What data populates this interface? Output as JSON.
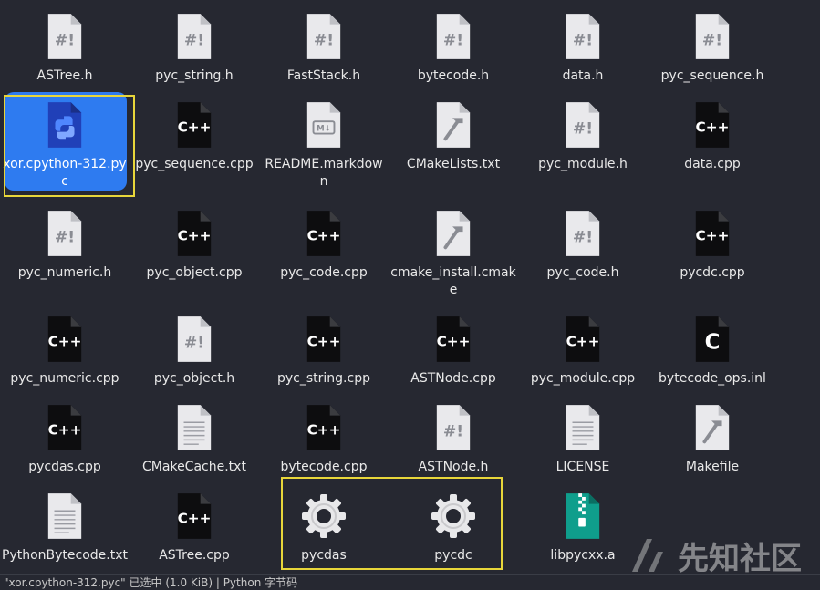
{
  "files": [
    {
      "name": "ASTree.h",
      "icon": "header-icon"
    },
    {
      "name": "pyc_string.h",
      "icon": "header-icon"
    },
    {
      "name": "FastStack.h",
      "icon": "header-icon"
    },
    {
      "name": "bytecode.h",
      "icon": "header-icon"
    },
    {
      "name": "data.h",
      "icon": "header-icon"
    },
    {
      "name": "pyc_sequence.h",
      "icon": "header-icon"
    },
    {
      "name": "xor.cpython-312.pyc",
      "icon": "python-icon",
      "selected": true
    },
    {
      "name": "pyc_sequence.cpp",
      "icon": "cpp-icon"
    },
    {
      "name": "README.markdown",
      "icon": "markdown-icon"
    },
    {
      "name": "CMakeLists.txt",
      "icon": "build-icon"
    },
    {
      "name": "pyc_module.h",
      "icon": "header-icon"
    },
    {
      "name": "data.cpp",
      "icon": "cpp-icon"
    },
    {
      "name": "pyc_numeric.h",
      "icon": "header-icon"
    },
    {
      "name": "pyc_object.cpp",
      "icon": "cpp-icon"
    },
    {
      "name": "pyc_code.cpp",
      "icon": "cpp-icon"
    },
    {
      "name": "cmake_install.cmake",
      "icon": "build-icon"
    },
    {
      "name": "pyc_code.h",
      "icon": "header-icon"
    },
    {
      "name": "pycdc.cpp",
      "icon": "cpp-icon"
    },
    {
      "name": "pyc_numeric.cpp",
      "icon": "cpp-icon"
    },
    {
      "name": "pyc_object.h",
      "icon": "header-icon"
    },
    {
      "name": "pyc_string.cpp",
      "icon": "cpp-icon"
    },
    {
      "name": "ASTNode.cpp",
      "icon": "cpp-icon"
    },
    {
      "name": "pyc_module.cpp",
      "icon": "cpp-icon"
    },
    {
      "name": "bytecode_ops.inl",
      "icon": "c-icon"
    },
    {
      "name": "pycdas.cpp",
      "icon": "cpp-icon"
    },
    {
      "name": "CMakeCache.txt",
      "icon": "text-icon"
    },
    {
      "name": "bytecode.cpp",
      "icon": "cpp-icon"
    },
    {
      "name": "ASTNode.h",
      "icon": "header-icon"
    },
    {
      "name": "LICENSE",
      "icon": "text-icon"
    },
    {
      "name": "Makefile",
      "icon": "build-icon"
    },
    {
      "name": "PythonBytecode.txt",
      "icon": "text-icon"
    },
    {
      "name": "ASTree.cpp",
      "icon": "cpp-icon"
    },
    {
      "name": "pycdas",
      "icon": "executable-gear-icon"
    },
    {
      "name": "pycdc",
      "icon": "executable-gear-icon"
    },
    {
      "name": "libpycxx.a",
      "icon": "archive-icon"
    }
  ],
  "statusbar": {
    "text": "\"xor.cpython-312.pyc\" 已选中 (1.0 KiB) | Python 字节码"
  },
  "watermark": {
    "text": "先知社区"
  },
  "colors": {
    "background": "#262831",
    "selection": "#2e7bf0",
    "highlight_border": "#e8d63a"
  }
}
